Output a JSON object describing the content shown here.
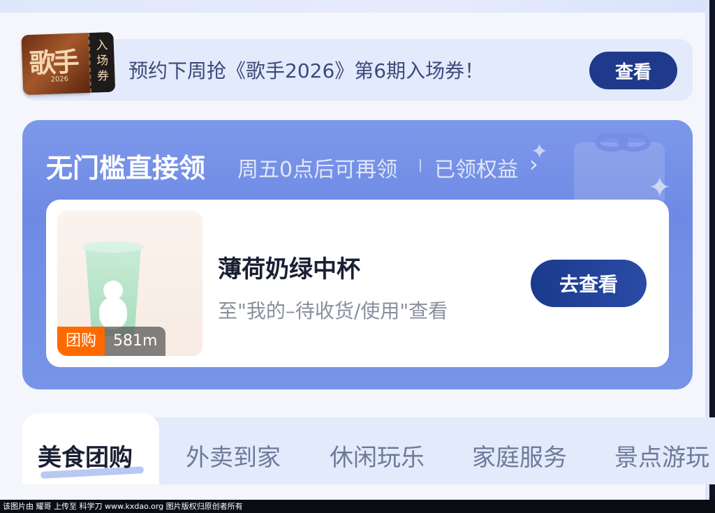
{
  "banner": {
    "ticket_logo": "歌手",
    "ticket_year": "2026",
    "ticket_stub": "入场券",
    "text": "预约下周抢《歌手2026》第6期入场券！",
    "button": "查看"
  },
  "promo": {
    "title": "无门槛直接领",
    "subtitle": "周五0点后可再领",
    "link": "已领权益",
    "coupon": {
      "item_name": "薄荷奶绿中杯",
      "description": "至\"我的–待收货/使用\"查看",
      "button": "去查看",
      "tag_type": "团购",
      "tag_distance": "581m"
    }
  },
  "tabs": {
    "items": [
      "美食团购",
      "外卖到家",
      "休闲玩乐",
      "家庭服务",
      "景点游玩"
    ],
    "active_index": 0
  },
  "watermark": "该图片由 耀哥 上传至 科学刀 www.kxdao.org 图片版权归原创者所有",
  "colors": {
    "primary_button": "#1f3a8a",
    "promo_bg": "#7d98ea",
    "tag_orange": "#ff6a00",
    "banner_bg": "#e3eafc"
  }
}
